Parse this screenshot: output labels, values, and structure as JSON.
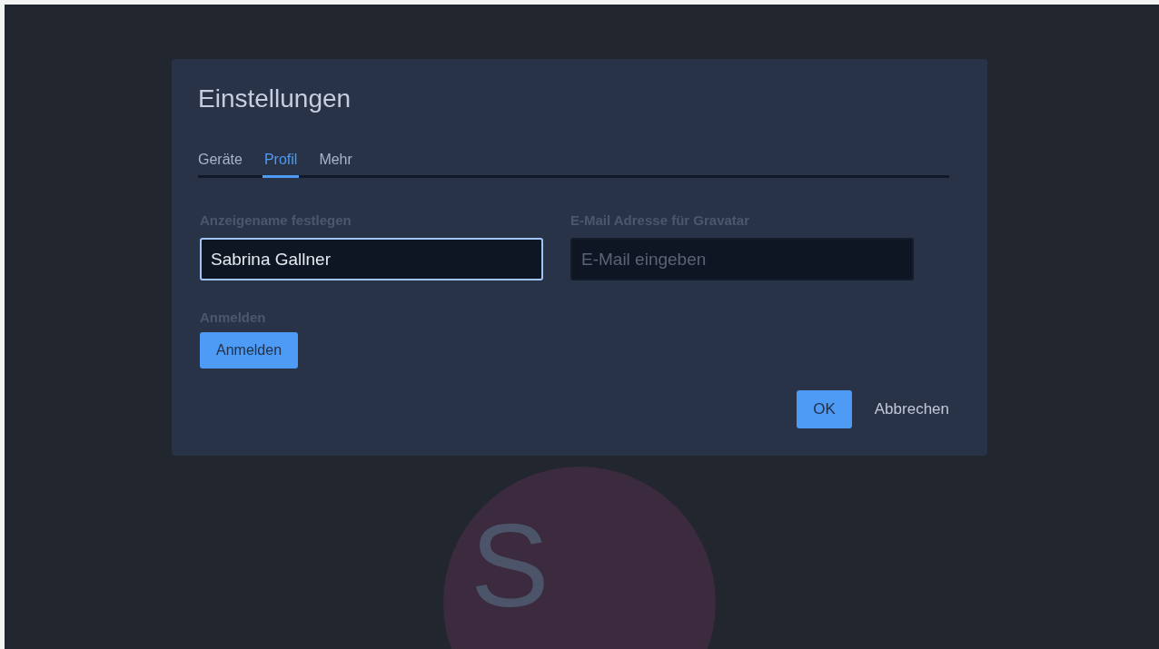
{
  "dialog": {
    "title": "Einstellungen",
    "tabs": [
      {
        "label": "Geräte",
        "selected": false
      },
      {
        "label": "Profil",
        "selected": true
      },
      {
        "label": "Mehr",
        "selected": false
      }
    ],
    "fields": [
      {
        "label": "Anzeigename festlegen",
        "value": "Sabrina Gallner",
        "focused": true
      },
      {
        "label": "E-Mail Adresse für Gravatar",
        "placeholder": "E-Mail eingeben",
        "focused": false
      }
    ],
    "login": {
      "label": "Anmelden",
      "button": "Anmelden"
    },
    "buttons": [
      {
        "label": "OK",
        "kind": "primary"
      },
      {
        "label": "Abbrechen",
        "kind": "plain"
      }
    ]
  },
  "avatar": {
    "initials": "S"
  }
}
